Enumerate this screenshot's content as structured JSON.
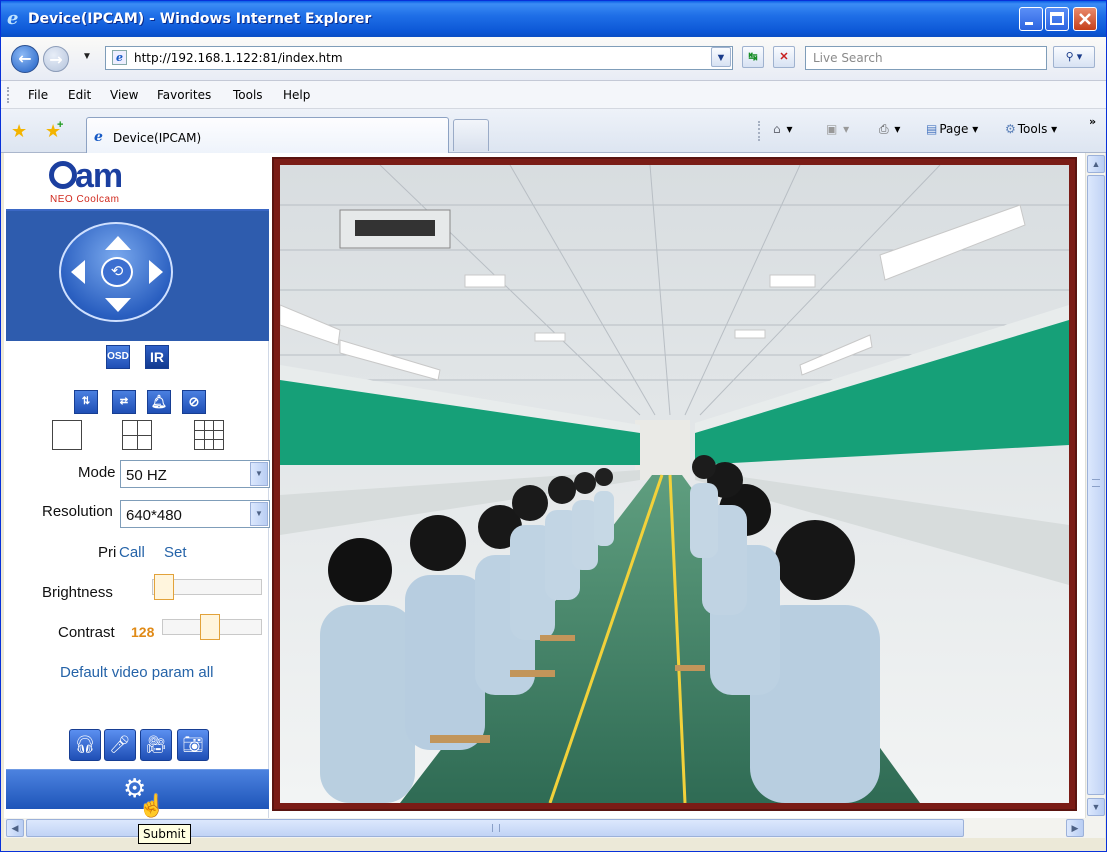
{
  "window": {
    "title": "Device(IPCAM) - Windows Internet Explorer",
    "controls": {
      "minimize_icon": "minimize-icon",
      "maximize_icon": "maximize-icon",
      "close_icon": "close-icon"
    }
  },
  "address_bar": {
    "url": "http://192.168.1.122:81/index.htm",
    "search_placeholder": "Live Search"
  },
  "menu": {
    "items": [
      "File",
      "Edit",
      "View",
      "Favorites",
      "Tools",
      "Help"
    ]
  },
  "tabs": {
    "active_label": "Device(IPCAM)"
  },
  "command_bar": {
    "page_label": "Page",
    "tools_label": "Tools",
    "chevron": "»"
  },
  "camera_panel": {
    "logo_text": "am",
    "logo_sub": "NEO Coolcam",
    "osd_label": "OSD",
    "ir_label": "IR",
    "mode_label": "Mode",
    "mode_value": "50 HZ",
    "resolution_label": "Resolution",
    "resolution_value": "640*480",
    "preset_label": "Pri",
    "preset_call": "Call",
    "preset_set": "Set",
    "brightness_label": "Brightness",
    "brightness_level": 0.1,
    "contrast_label": "Contrast",
    "contrast_value": "128",
    "contrast_level": 0.5,
    "default_link": "Default video param all"
  },
  "tooltip": {
    "text": "Submit"
  },
  "colors": {
    "titlebar": "#0c57d6",
    "panel_blue": "#2e5cae",
    "link_blue": "#2563a8",
    "contrast_orange": "#e08a16",
    "video_border": "#7a1c16"
  }
}
